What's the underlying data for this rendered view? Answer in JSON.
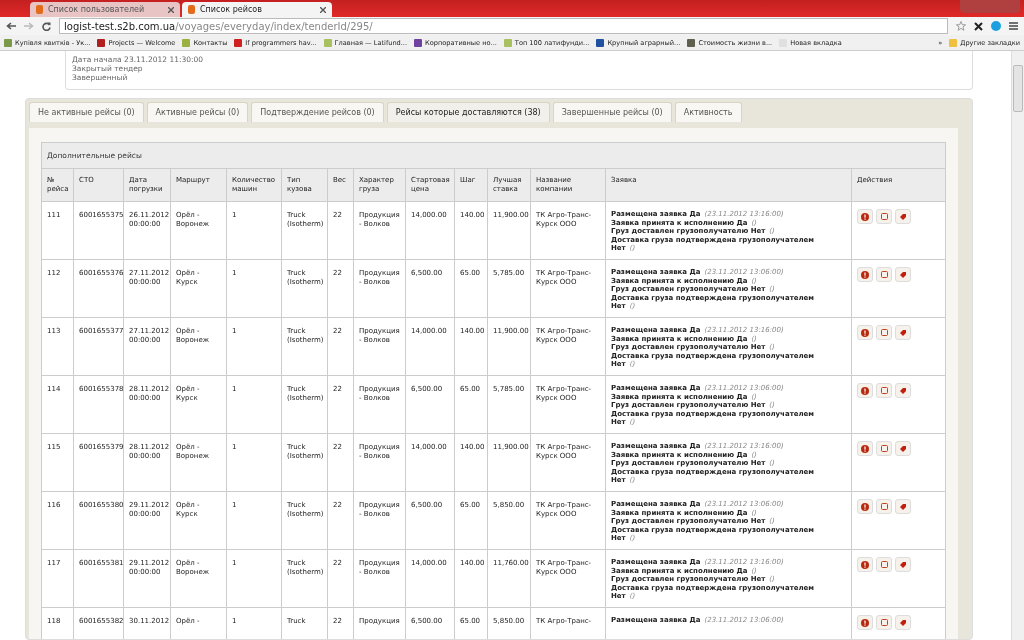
{
  "browser": {
    "tabs": [
      {
        "title": "Список пользователей",
        "selected": false
      },
      {
        "title": "Список рейсов",
        "selected": true
      }
    ],
    "address": {
      "host": "logist-test.s2b.com.ua",
      "path": "/voyages/everyday/index/tenderId/295/"
    },
    "bookmarks": [
      {
        "label": "Купівля квитків - Ук...",
        "color": "#7a9a4a"
      },
      {
        "label": "Projects — Welcome",
        "color": "#b02020"
      },
      {
        "label": "Контакты",
        "color": "#9ab040"
      },
      {
        "label": "If programmers hav...",
        "color": "#d02020"
      },
      {
        "label": "Главная — Latifund...",
        "color": "#a8c060"
      },
      {
        "label": "Корпоративные но...",
        "color": "#7040a0"
      },
      {
        "label": "Топ 100 латифунди...",
        "color": "#a8c060"
      },
      {
        "label": "Крупный аграрный...",
        "color": "#2050a0"
      },
      {
        "label": "Стоимость жизни в...",
        "color": "#606050"
      },
      {
        "label": "Новая вкладка",
        "color": "#e0e0e0"
      }
    ],
    "overflow": "»",
    "other_bookmarks": "Другие закладки"
  },
  "info": [
    "Дата начала 23.11.2012 11:30:00",
    "Закрытый тендер",
    "Завершенный"
  ],
  "tabs": [
    {
      "label": "Не активные рейсы (0)",
      "selected": false
    },
    {
      "label": "Активные рейсы (0)",
      "selected": false
    },
    {
      "label": "Подтверждение рейсов (0)",
      "selected": false
    },
    {
      "label": "Рейсы которые доставляются (38)",
      "selected": true
    },
    {
      "label": "Завершенные рейсы (0)",
      "selected": false
    },
    {
      "label": "Активность",
      "selected": false
    }
  ],
  "table": {
    "caption": "Дополнительные рейсы",
    "columns": [
      "№ рейса",
      "СТО",
      "Дата погрузки",
      "Маршрут",
      "Количество машин",
      "Тип кузова",
      "Вес",
      "Характер груза",
      "Стартовая цена",
      "Шаг",
      "Лучшая ставка",
      "Название компании",
      "Заявка",
      "Действия"
    ],
    "rows": [
      {
        "cells": [
          "111",
          "6001655375",
          "26.11.2012 00:00:00",
          "Орёл - Воронеж",
          "1",
          "Truck (Isotherm)",
          "22",
          "Продукция - Волков",
          "14,000.00",
          "140.00",
          "11,900.00",
          "ТК Агро-Транс-Курск ООО"
        ],
        "application": [
          {
            "text": "Размещена заявка Да",
            "note": "(23.11.2012 13:16:00)"
          },
          {
            "text": "Заявка принята к исполнению Да",
            "note": "()"
          },
          {
            "text": "Груз доставлен грузополучателю Нет",
            "note": "()"
          },
          {
            "text": "Доставка груза подтверждена грузополучателем Нет",
            "note": "()"
          }
        ]
      },
      {
        "cells": [
          "112",
          "6001655376",
          "27.11.2012 00:00:00",
          "Орёл - Курск",
          "1",
          "Truck (Isotherm)",
          "22",
          "Продукция - Волков",
          "6,500.00",
          "65.00",
          "5,785.00",
          "ТК Агро-Транс-Курск ООО"
        ],
        "application": [
          {
            "text": "Размещена заявка Да",
            "note": "(23.11.2012 13:06:00)"
          },
          {
            "text": "Заявка принята к исполнению Да",
            "note": "()"
          },
          {
            "text": "Груз доставлен грузополучателю Нет",
            "note": "()"
          },
          {
            "text": "Доставка груза подтверждена грузополучателем Нет",
            "note": "()"
          }
        ]
      },
      {
        "cells": [
          "113",
          "6001655377",
          "27.11.2012 00:00:00",
          "Орёл - Воронеж",
          "1",
          "Truck (Isotherm)",
          "22",
          "Продукция - Волков",
          "14,000.00",
          "140.00",
          "11,900.00",
          "ТК Агро-Транс-Курск ООО"
        ],
        "application": [
          {
            "text": "Размещена заявка Да",
            "note": "(23.11.2012 13:16:00)"
          },
          {
            "text": "Заявка принята к исполнению Да",
            "note": "()"
          },
          {
            "text": "Груз доставлен грузополучателю Нет",
            "note": "()"
          },
          {
            "text": "Доставка груза подтверждена грузополучателем Нет",
            "note": "()"
          }
        ]
      },
      {
        "cells": [
          "114",
          "6001655378",
          "28.11.2012 00:00:00",
          "Орёл - Курск",
          "1",
          "Truck (Isotherm)",
          "22",
          "Продукция - Волков",
          "6,500.00",
          "65.00",
          "5,785.00",
          "ТК Агро-Транс-Курск ООО"
        ],
        "application": [
          {
            "text": "Размещена заявка Да",
            "note": "(23.11.2012 13:06:00)"
          },
          {
            "text": "Заявка принята к исполнению Да",
            "note": "()"
          },
          {
            "text": "Груз доставлен грузополучателю Нет",
            "note": "()"
          },
          {
            "text": "Доставка груза подтверждена грузополучателем Нет",
            "note": "()"
          }
        ]
      },
      {
        "cells": [
          "115",
          "6001655379",
          "28.11.2012 00:00:00",
          "Орёл - Воронеж",
          "1",
          "Truck (Isotherm)",
          "22",
          "Продукция - Волков",
          "14,000.00",
          "140.00",
          "11,900.00",
          "ТК Агро-Транс-Курск ООО"
        ],
        "application": [
          {
            "text": "Размещена заявка Да",
            "note": "(23.11.2012 13:16:00)"
          },
          {
            "text": "Заявка принята к исполнению Да",
            "note": "()"
          },
          {
            "text": "Груз доставлен грузополучателю Нет",
            "note": "()"
          },
          {
            "text": "Доставка груза подтверждена грузополучателем Нет",
            "note": "()"
          }
        ]
      },
      {
        "cells": [
          "116",
          "6001655380",
          "29.11.2012 00:00:00",
          "Орёл - Курск",
          "1",
          "Truck (Isotherm)",
          "22",
          "Продукция - Волков",
          "6,500.00",
          "65.00",
          "5,850.00",
          "ТК Агро-Транс-Курск ООО"
        ],
        "application": [
          {
            "text": "Размещена заявка Да",
            "note": "(23.11.2012 13:06:00)"
          },
          {
            "text": "Заявка принята к исполнению Да",
            "note": "()"
          },
          {
            "text": "Груз доставлен грузополучателю Нет",
            "note": "()"
          },
          {
            "text": "Доставка груза подтверждена грузополучателем Нет",
            "note": "()"
          }
        ]
      },
      {
        "cells": [
          "117",
          "6001655381",
          "29.11.2012 00:00:00",
          "Орёл - Воронеж",
          "1",
          "Truck (Isotherm)",
          "22",
          "Продукция - Волков",
          "14,000.00",
          "140.00",
          "11,760.00",
          "ТК Агро-Транс-Курск ООО"
        ],
        "application": [
          {
            "text": "Размещена заявка Да",
            "note": "(23.11.2012 13:16:00)"
          },
          {
            "text": "Заявка принята к исполнению Да",
            "note": "()"
          },
          {
            "text": "Груз доставлен грузополучателю Нет",
            "note": "()"
          },
          {
            "text": "Доставка груза подтверждена грузополучателем Нет",
            "note": "()"
          }
        ]
      },
      {
        "cells": [
          "118",
          "6001655382",
          "30.11.2012",
          "Орёл -",
          "1",
          "Truck",
          "22",
          "Продукция",
          "6,500.00",
          "65.00",
          "5,850.00",
          "ТК Агро-Транс-"
        ],
        "application": [
          {
            "text": "Размещена заявка Да",
            "note": "(23.11.2012 13:06:00)"
          }
        ]
      }
    ]
  }
}
